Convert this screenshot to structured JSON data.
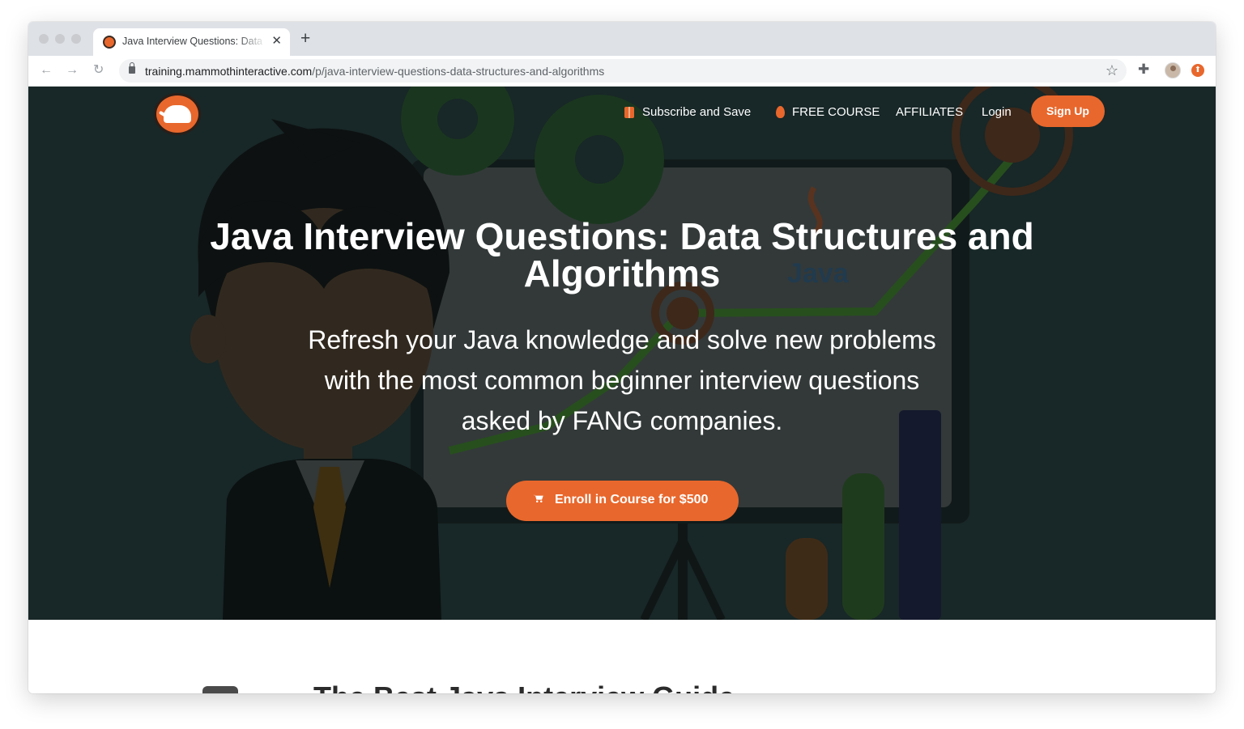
{
  "browser": {
    "tab": {
      "title": "Java Interview Questions: Data Structures and Algorithms"
    },
    "url": {
      "host": "training.mammothinteractive.com",
      "path": "/p/java-interview-questions-data-structures-and-algorithms"
    },
    "icons": [
      "back-icon",
      "forward-icon",
      "reload-icon",
      "lock-icon",
      "star-icon",
      "extensions-icon",
      "profile-avatar",
      "update-icon"
    ]
  },
  "nav": {
    "subscribe": "Subscribe and Save",
    "free_course": "FREE COURSE",
    "affiliates": "AFFILIATES",
    "login": "Login",
    "signup": "Sign Up"
  },
  "hero": {
    "title": "Java Interview Questions: Data Structures and Algorithms",
    "subtitle": "Refresh your Java knowledge and solve new problems with the most common beginner interview questions asked by FANG companies.",
    "cta": "Enroll in Course for $500",
    "art_label": "Java"
  },
  "content": {
    "heading": "The Best Java Interview Guide"
  },
  "colors": {
    "accent": "#e8672c",
    "hero_bg": "#1c2b2b",
    "white": "#ffffff"
  }
}
